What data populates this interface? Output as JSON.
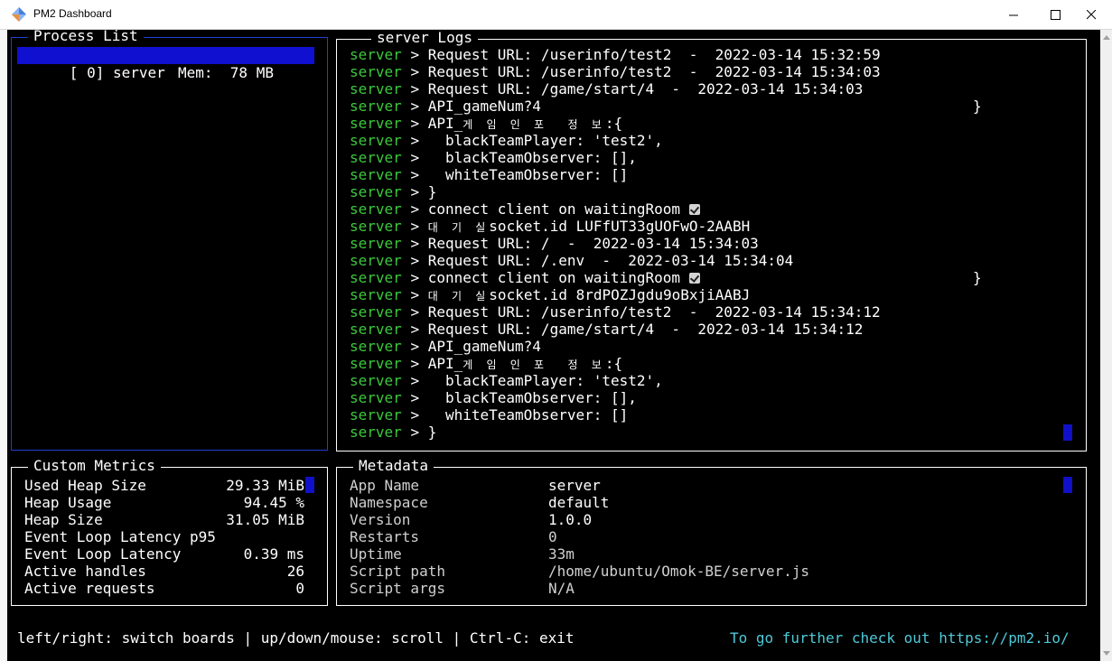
{
  "window": {
    "title": "PM2 Dashboard"
  },
  "process_list": {
    "title": "Process List",
    "items": [
      {
        "label": "[ 0] server",
        "mem": "Mem:  78 MB"
      }
    ]
  },
  "logs": {
    "title": "server Logs",
    "prefix": "server",
    "lines": [
      "> Request URL: /userinfo/test2  -  2022-03-14 15:32:59",
      "> Request URL: /userinfo/test2  -  2022-03-14 15:34:03",
      "> Request URL: /game/start/4  -  2022-03-14 15:34:03",
      "> API_gameNum?4",
      "> API_",
      ">   blackTeamPlayer: 'test2',",
      ">   blackTeamObserver: [],",
      ">   whiteTeamObserver: []",
      "> }",
      "> connect client on waitingRoom",
      ">",
      "> Request URL: /  -  2022-03-14 15:34:03",
      "> Request URL: /.env  -  2022-03-14 15:34:04",
      "> connect client on waitingRoom",
      ">",
      "> Request URL: /userinfo/test2  -  2022-03-14 15:34:12",
      "> Request URL: /game/start/4  -  2022-03-14 15:34:12",
      "> API_gameNum?4",
      "> API_",
      ">   blackTeamPlayer: 'test2',",
      ">   blackTeamObserver: [],",
      ">   whiteTeamObserver: []",
      "> }"
    ],
    "korean_game_info": "게 임 인 포  정 보",
    "korean_game_info_tail": ":{",
    "korean_waiting": "대 기 실",
    "socket_1": "socket.id LUFfUT33gUOFwO-2AABH",
    "socket_2": "socket.id 8rdPOZJgdu9oBxjiAABJ",
    "stray_brace": "}"
  },
  "metrics": {
    "title": "Custom Metrics",
    "rows": [
      {
        "name": "Used Heap Size",
        "value": "29.33 MiB"
      },
      {
        "name": "Heap Usage",
        "value": "94.45 %"
      },
      {
        "name": "Heap Size",
        "value": "31.05 MiB"
      },
      {
        "name": "Event Loop Latency p95",
        "value": ""
      },
      {
        "name": "Event Loop Latency",
        "value": "0.39 ms"
      },
      {
        "name": "Active handles",
        "value": "26"
      },
      {
        "name": "Active requests",
        "value": "0"
      }
    ]
  },
  "metadata": {
    "title": "Metadata",
    "rows": [
      {
        "key": "App Name",
        "value": "server"
      },
      {
        "key": "Namespace",
        "value": "default"
      },
      {
        "key": "Version",
        "value": "1.0.0"
      },
      {
        "key": "Restarts",
        "value": "0"
      },
      {
        "key": "Uptime",
        "value": "33m"
      },
      {
        "key": "Script path",
        "value": "/home/ubuntu/Omok-BE/server.js"
      },
      {
        "key": "Script args",
        "value": "N/A"
      }
    ]
  },
  "footer": {
    "help": "left/right: switch boards | up/down/mouse: scroll | Ctrl-C: exit",
    "link": "To go further check out https://pm2.io/"
  },
  "colors": {
    "log_prefix": "#3cc83c",
    "selection": "#1010d0",
    "link": "#4ec9d8",
    "border": "#ffffff"
  }
}
